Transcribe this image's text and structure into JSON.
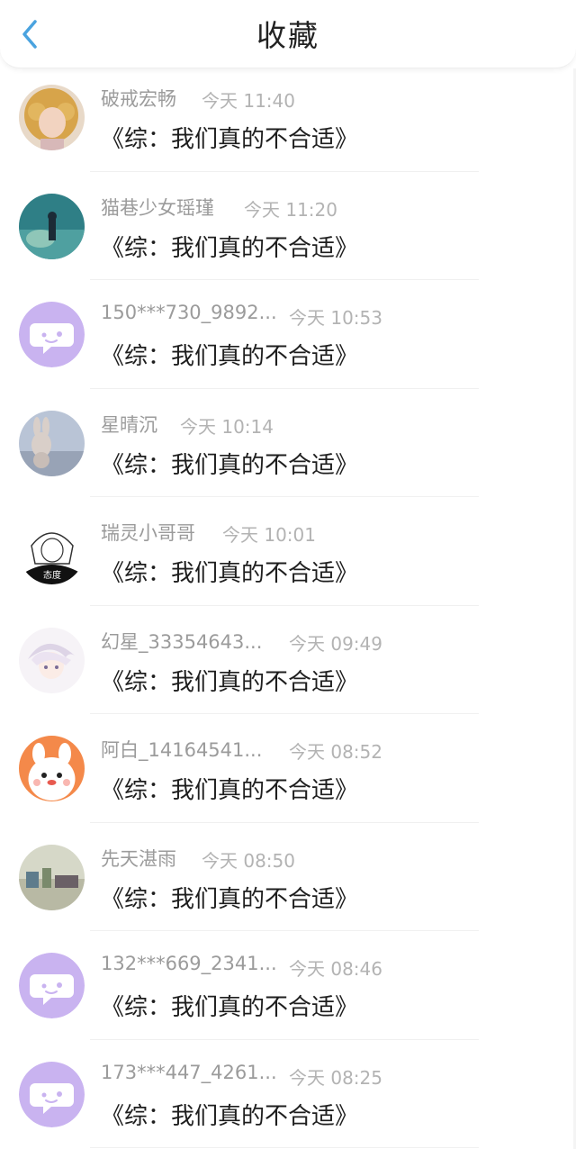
{
  "header": {
    "title": "收藏",
    "back_icon": "chevron-left-icon",
    "accent": "#4aa3df"
  },
  "items": [
    {
      "name": "破戒宏畅",
      "time": "今天 11:40",
      "title": "《综：我们真的不合适》",
      "avatar": "photo-curly-hair"
    },
    {
      "name": "猫巷少女瑶瑾",
      "time": "今天 11:20",
      "title": "《综：我们真的不合适》",
      "avatar": "photo-teal-scene"
    },
    {
      "name": "150***730_9892...",
      "time": "今天 10:53",
      "title": "《综：我们真的不合适》",
      "avatar": "default-chat-bubble"
    },
    {
      "name": "星晴沉",
      "time": "今天 10:14",
      "title": "《综：我们真的不合适》",
      "avatar": "photo-rabbit-toy"
    },
    {
      "name": "瑞灵小哥哥",
      "time": "今天 10:01",
      "title": "《综：我们真的不合适》",
      "avatar": "anime-sketch-girl"
    },
    {
      "name": "幻星_33354643...",
      "time": "今天 09:49",
      "title": "《综：我们真的不合适》",
      "avatar": "anime-white-hair"
    },
    {
      "name": "阿白_14164541...",
      "time": "今天 08:52",
      "title": "《综：我们真的不合适》",
      "avatar": "cartoon-bunny"
    },
    {
      "name": "先天湛雨",
      "time": "今天 08:50",
      "title": "《综：我们真的不合适》",
      "avatar": "photo-desk"
    },
    {
      "name": "132***669_2341...",
      "time": "今天 08:46",
      "title": "《综：我们真的不合适》",
      "avatar": "default-chat-bubble"
    },
    {
      "name": "173***447_4261...",
      "time": "今天 08:25",
      "title": "《综：我们真的不合适》",
      "avatar": "default-chat-bubble"
    }
  ],
  "colors": {
    "default_avatar": "#c9b3f0",
    "name_text": "#9b9b9b",
    "time_text": "#b3b3b3",
    "title_text": "#1e1e1e"
  }
}
